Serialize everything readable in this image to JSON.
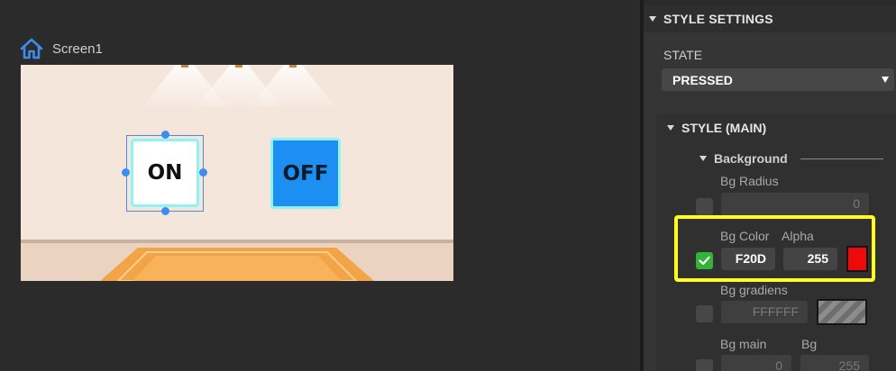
{
  "canvas": {
    "screen_tab_label": "Screen1",
    "buttons": {
      "on_label": "ON",
      "off_label": "OFF"
    }
  },
  "panel": {
    "style_settings_title": "STYLE SETTINGS",
    "state": {
      "label": "STATE",
      "selected": "PRESSED"
    },
    "style_main": {
      "title": "STYLE (MAIN)",
      "background": {
        "title": "Background",
        "bg_radius": {
          "label": "Bg Radius",
          "enabled": false,
          "value": "0"
        },
        "bg_color": {
          "label": "Bg Color",
          "enabled": true,
          "hex": "F20D",
          "alpha_label": "Alpha",
          "alpha": "255",
          "swatch_color": "#ee0a0a"
        },
        "bg_gradient": {
          "label": "Bg gradiens",
          "enabled": false,
          "hex": "FFFFFF"
        },
        "bg_main": {
          "label": "Bg main",
          "enabled": false,
          "value": "0",
          "second_label": "Bg",
          "second_value": "255"
        }
      }
    }
  },
  "colors": {
    "highlight": "#ffff1a",
    "on_button_border": "#8ff3f5",
    "off_button_fill": "#1e8ff2",
    "checkbox_on": "#34b33b",
    "home_icon": "#3d8df0"
  }
}
